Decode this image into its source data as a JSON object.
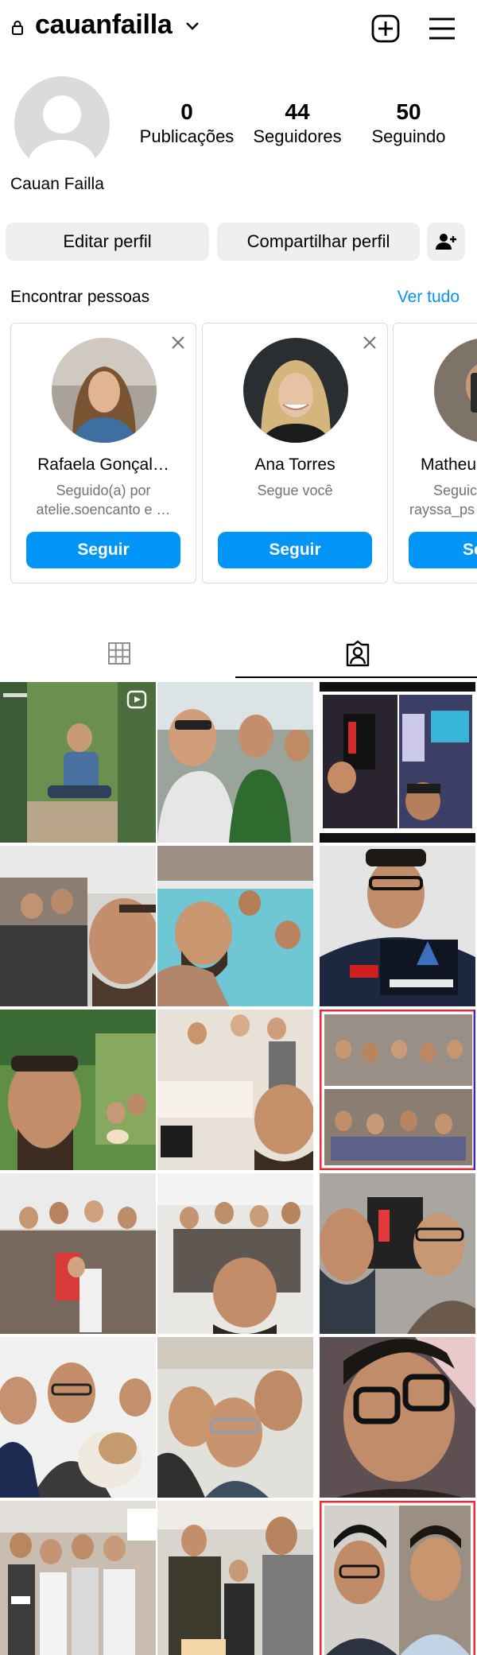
{
  "header": {
    "username": "cauanfailla",
    "lock_icon": "lock-icon",
    "menu_icon": "hamburger-icon",
    "create_icon": "plus-square-icon"
  },
  "profile": {
    "full_name": "Cauan Failla",
    "stats": [
      {
        "value": "0",
        "label": "Publicações"
      },
      {
        "value": "44",
        "label": "Seguidores"
      },
      {
        "value": "50",
        "label": "Seguindo"
      }
    ],
    "edit_label": "Editar perfil",
    "share_label": "Compartilhar perfil"
  },
  "discover": {
    "title": "Encontrar pessoas",
    "see_all": "Ver tudo",
    "cards": [
      {
        "name": "Rafaela Gonçal…",
        "line1": "Seguido(a) por",
        "line2": "atelie.soencanto e …",
        "button": "Seguir"
      },
      {
        "name": "Ana Torres",
        "line1": "Segue você",
        "line2": "",
        "button": "Seguir"
      },
      {
        "name": "Matheu",
        "line1": "Seguic",
        "line2": "rayssa_ps",
        "button": "Se"
      }
    ]
  },
  "tabs": [
    {
      "icon": "grid-icon"
    },
    {
      "icon": "tagged-person-icon"
    }
  ],
  "colors": {
    "accent": "#0095f6",
    "button_grey": "#efefef",
    "secondary_text": "#737373"
  }
}
